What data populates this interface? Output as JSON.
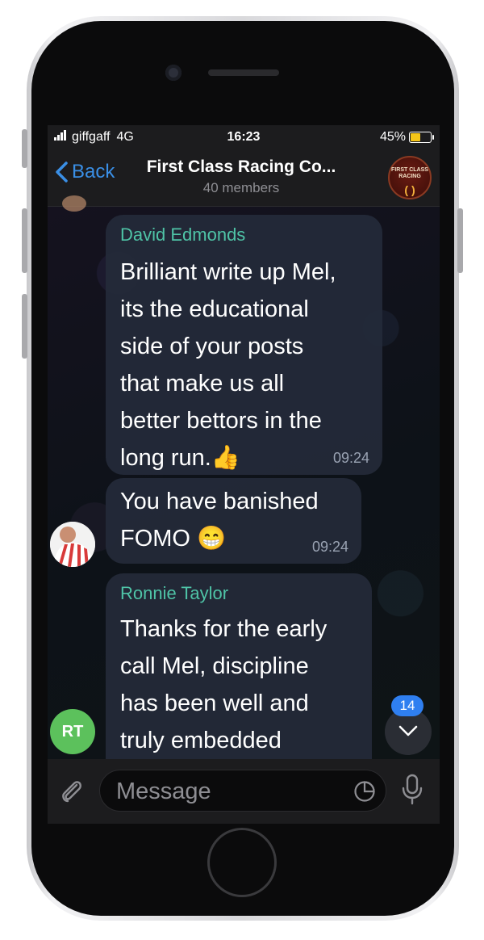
{
  "status_bar": {
    "carrier": "giffgaff",
    "network": "4G",
    "time": "16:23",
    "battery": "45%",
    "battery_level": 0.45
  },
  "header": {
    "back_label": "Back",
    "title": "First Class Racing Co...",
    "subtitle": "40 members",
    "avatar_text": "FIRST CLASS RACING",
    "avatar_mark": "( )"
  },
  "messages": [
    {
      "sender": "David Edmonds",
      "text": "Brilliant write up Mel,\nits the educational\nside of your posts\nthat make us all\nbetter bettors in the\nlong run.👍",
      "time": "09:24"
    },
    {
      "text": "You have banished\nFOMO 😁",
      "time": "09:24"
    },
    {
      "sender": "Ronnie Taylor",
      "text": "Thanks for the early\ncall Mel, discipline\nhas been well and\ntruly embedded",
      "avatar_initials": "RT"
    }
  ],
  "scroll_badge": "14",
  "composer": {
    "placeholder": "Message"
  },
  "colors": {
    "accent": "#3a8fe6",
    "sender": "#4fc4a7",
    "badge": "#2f7ff0",
    "rt_avatar": "#5cc15c"
  },
  "icons": [
    "back-chevron-icon",
    "paperclip-icon",
    "sticker-icon",
    "microphone-icon",
    "chevron-down-icon"
  ]
}
